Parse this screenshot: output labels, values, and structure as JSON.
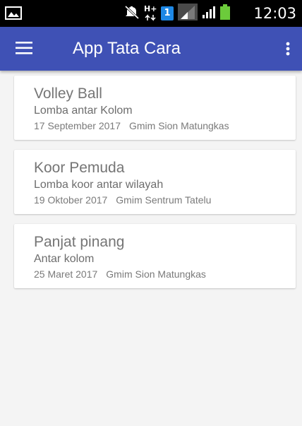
{
  "status_bar": {
    "time": "12:03",
    "icons": [
      "gallery-icon",
      "mute-icon",
      "data-transfer-icon",
      "sim-badge-icon",
      "signal-1-icon",
      "signal-2-icon",
      "battery-icon"
    ],
    "sim_badge": "1",
    "data_label": "H+"
  },
  "toolbar": {
    "title": "App Tata Cara",
    "menu_icon": "menu-icon",
    "overflow_icon": "more-vert-icon",
    "color": "#3f51b5"
  },
  "events": [
    {
      "title": "Volley Ball",
      "subtitle": "Lomba antar Kolom",
      "date": "17 September 2017",
      "place": "Gmim Sion Matungkas"
    },
    {
      "title": "Koor Pemuda",
      "subtitle": "Lomba koor antar wilayah",
      "date": "19 Oktober 2017",
      "place": "Gmim Sentrum Tatelu"
    },
    {
      "title": "Panjat pinang",
      "subtitle": "Antar kolom",
      "date": "25 Maret 2017",
      "place": "Gmim Sion Matungkas"
    }
  ]
}
